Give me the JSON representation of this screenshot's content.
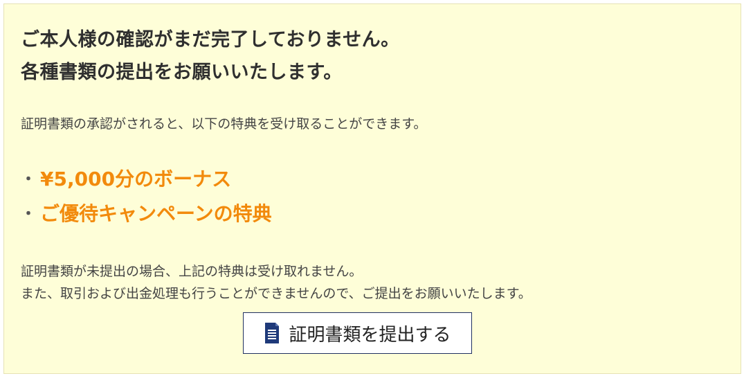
{
  "headline": {
    "line1": "ご本人様の確認がまだ完了しておりません。",
    "line2": "各種書類の提出をお願いいたします。"
  },
  "intro": "証明書類の承認がされると、以下の特典を受け取ることができます。",
  "benefits": [
    {
      "bullet": "・",
      "label": "¥5,000分のボーナス"
    },
    {
      "bullet": "・",
      "label": "ご優待キャンペーンの特典"
    }
  ],
  "warning": {
    "line1": "証明書類が未提出の場合、上記の特典は受け取れません。",
    "line2": "また、取引および出金処理も行うことができませんので、ご提出をお願いいたします。"
  },
  "submit_button": {
    "label": "証明書類を提出する",
    "icon": "document-icon"
  },
  "colors": {
    "panel_background": "#fefed8",
    "accent": "#f28a0c",
    "button_border": "#1f2f5f",
    "icon": "#1f3a7a"
  }
}
